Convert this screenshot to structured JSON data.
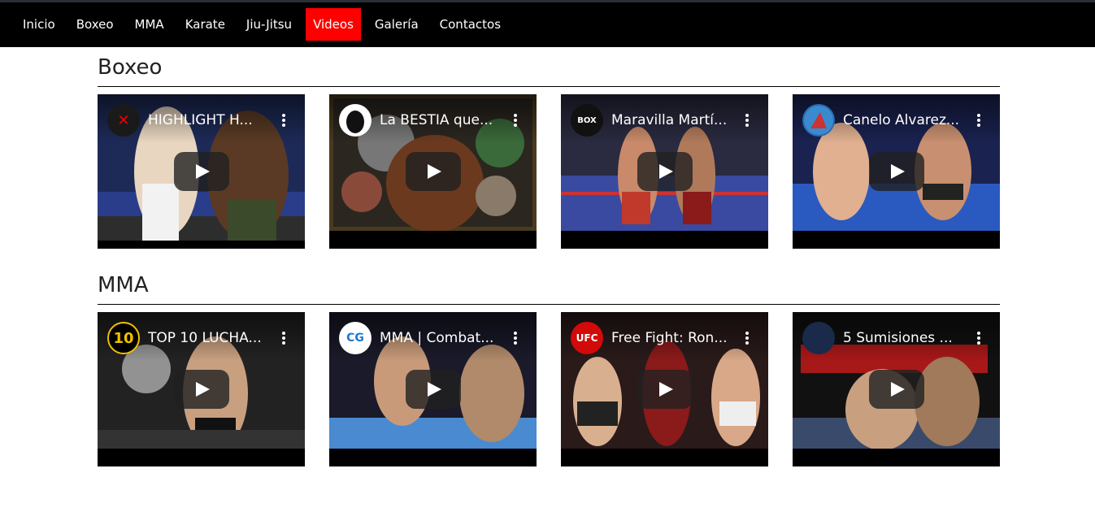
{
  "nav": {
    "items": [
      {
        "label": "Inicio",
        "active": false
      },
      {
        "label": "Boxeo",
        "active": false
      },
      {
        "label": "MMA",
        "active": false
      },
      {
        "label": "Karate",
        "active": false
      },
      {
        "label": "Jiu-Jitsu",
        "active": false
      },
      {
        "label": "Videos",
        "active": true
      },
      {
        "label": "Galería",
        "active": false
      },
      {
        "label": "Contactos",
        "active": false
      }
    ],
    "active_color": "#ff0000"
  },
  "sections": [
    {
      "title": "Boxeo",
      "videos": [
        {
          "title": "HIGHLIGHT H...",
          "channel_badge": "✕"
        },
        {
          "title": "La BESTIA que...",
          "channel_badge": ""
        },
        {
          "title": "Maravilla Martí...",
          "channel_badge": "BOX"
        },
        {
          "title": "Canelo Alvarez...",
          "channel_badge": ""
        }
      ]
    },
    {
      "title": "MMA",
      "videos": [
        {
          "title": "TOP 10 LUCHA...",
          "channel_badge": "10"
        },
        {
          "title": "MMA | Combat...",
          "channel_badge": "CG"
        },
        {
          "title": "Free Fight: Ron...",
          "channel_badge": "UFC"
        },
        {
          "title": "5 Sumisiones ...",
          "channel_badge": ""
        }
      ]
    }
  ]
}
